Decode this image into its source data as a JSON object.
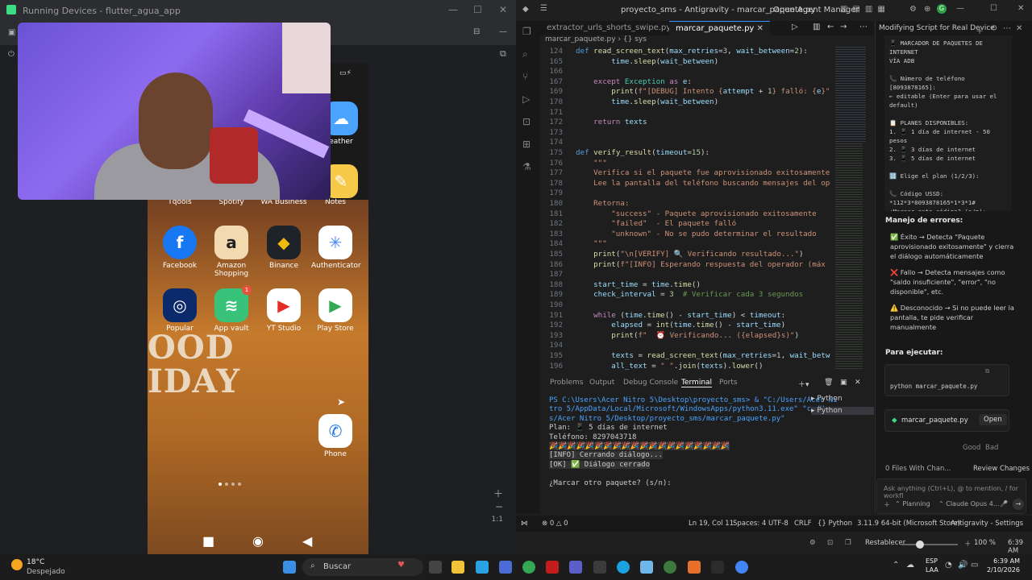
{
  "left_window": {
    "title": "Running Devices - flutter_agua_app",
    "zoom_label": "1:1"
  },
  "phone": {
    "status_battery": "batt",
    "row0": [
      {
        "label": "Tqools"
      },
      {
        "label": "Spotify"
      },
      {
        "label": "WA Business"
      },
      {
        "label": "Notes"
      }
    ],
    "right_partial": [
      {
        "label": "eather"
      }
    ],
    "row1": [
      {
        "label": "Facebook",
        "glyph": "f",
        "color": "#1877f2"
      },
      {
        "label": "Amazon Shopping",
        "glyph": "a",
        "color": "#f3d9b0"
      },
      {
        "label": "Binance",
        "glyph": "◆",
        "color": "#1e2329"
      },
      {
        "label": "Authenticator",
        "glyph": "✳",
        "color": "#ffffff"
      }
    ],
    "row2": [
      {
        "label": "Popular",
        "glyph": "◎",
        "color": "#0b2a6b"
      },
      {
        "label": "App vault",
        "glyph": "≋",
        "color": "#39c27a"
      },
      {
        "label": "YT Studio",
        "glyph": "▶",
        "color": "#ffffff"
      },
      {
        "label": "Play Store",
        "glyph": "▶",
        "color": "#ffffff"
      }
    ],
    "badge": "1",
    "dock": {
      "label": "Phone",
      "glyph": "✆",
      "color": "#ffffff"
    },
    "wall_line1": "OOD",
    "wall_line2": "IDAY"
  },
  "ide": {
    "title": "proyecto_sms - Antigravity - marcar_paquete.py",
    "open_agent": "Open Agent Manager",
    "tabs": [
      {
        "label": "extractor_urls_shorts_swipe.py",
        "active": false
      },
      {
        "label": "marcar_paquete.py",
        "active": true
      }
    ],
    "breadcrumb": "marcar_paquete.py  ›  {} sys",
    "lines": [
      {
        "n": "124",
        "html": "<span class='kw'>def</span> <span class='fn'>read_screen_text</span>(<span class='var'>max_retries</span>=<span class='num'>3</span>, <span class='var'>wait_between</span>=<span class='num'>2</span>):"
      },
      {
        "n": "165",
        "html": "        <span class='var'>time</span>.<span class='fn'>sleep</span>(<span class='var'>wait_between</span>)"
      },
      {
        "n": "166",
        "html": ""
      },
      {
        "n": "167",
        "html": "    <span class='kw2'>except</span> <span class='cls'>Exception</span> <span class='kw2'>as</span> <span class='var'>e</span>:"
      },
      {
        "n": "169",
        "html": "        <span class='fn'>print</span>(<span class='str'>f\"[DEBUG] Intento {</span><span class='var'>attempt</span> + <span class='num'>1</span><span class='str'>} falló: {</span><span class='var'>e</span><span class='str'>}\"</span>"
      },
      {
        "n": "170",
        "html": "        <span class='var'>time</span>.<span class='fn'>sleep</span>(<span class='var'>wait_between</span>)"
      },
      {
        "n": "171",
        "html": ""
      },
      {
        "n": "172",
        "html": "    <span class='kw2'>return</span> <span class='var'>texts</span>"
      },
      {
        "n": "173",
        "html": ""
      },
      {
        "n": "174",
        "html": ""
      },
      {
        "n": "175",
        "html": "<span class='kw'>def</span> <span class='fn'>verify_result</span>(<span class='var'>timeout</span>=<span class='num'>15</span>):"
      },
      {
        "n": "176",
        "html": "    <span class='str'>\"\"\"</span>"
      },
      {
        "n": "177",
        "html": "    <span class='str'>Verifica si el paquete fue aprovisionado exitosamente o f</span>"
      },
      {
        "n": "178",
        "html": "    <span class='str'>Lee la pantalla del teléfono buscando mensajes del operad</span>"
      },
      {
        "n": "179",
        "html": ""
      },
      {
        "n": "180",
        "html": "    <span class='str'>Retorna:</span>"
      },
      {
        "n": "181",
        "html": "        <span class='str'>\"success\" - Paquete aprovisionado exitosamente</span>"
      },
      {
        "n": "182",
        "html": "        <span class='str'>\"failed\"  - El paquete falló</span>"
      },
      {
        "n": "183",
        "html": "        <span class='str'>\"unknown\" - No se pudo determinar el resultado</span>"
      },
      {
        "n": "184",
        "html": "    <span class='str'>\"\"\"</span>"
      },
      {
        "n": "185",
        "html": "    <span class='fn'>print</span>(<span class='str'>\"\\n[VERIFY] 🔍 Verificando resultado...\"</span>)"
      },
      {
        "n": "186",
        "html": "    <span class='fn'>print</span>(<span class='str'>f\"[INFO] Esperando respuesta del operador (máx {tim</span>"
      },
      {
        "n": "187",
        "html": ""
      },
      {
        "n": "188",
        "html": "    <span class='var'>start_time</span> = <span class='var'>time</span>.<span class='fn'>time</span>()"
      },
      {
        "n": "189",
        "html": "    <span class='var'>check_interval</span> = <span class='num'>3</span>  <span class='cm'># Verificar cada 3 segundos</span>"
      },
      {
        "n": "190",
        "html": ""
      },
      {
        "n": "191",
        "html": "    <span class='kw2'>while</span> (<span class='var'>time</span>.<span class='fn'>time</span>() - <span class='var'>start_time</span>) &lt; <span class='var'>timeout</span>:"
      },
      {
        "n": "192",
        "html": "        <span class='var'>elapsed</span> = <span class='fn'>int</span>(<span class='var'>time</span>.<span class='fn'>time</span>() - <span class='var'>start_time</span>)"
      },
      {
        "n": "193",
        "html": "        <span class='fn'>print</span>(<span class='str'>f\"  ⏰ Verificando... ({elapsed}s)\"</span>)"
      },
      {
        "n": "194",
        "html": ""
      },
      {
        "n": "195",
        "html": "        <span class='var'>texts</span> = <span class='fn'>read_screen_text</span>(<span class='var'>max_retries</span>=<span class='num'>1</span>, <span class='var'>wait_between</span>="
      },
      {
        "n": "196",
        "html": "        <span class='var'>all_text</span> = <span class='str'>\" \"</span>.<span class='fn'>join</span>(<span class='var'>texts</span>).<span class='fn'>lower</span>()"
      }
    ],
    "panel_tabs": [
      "Problems",
      "Output",
      "Debug Console",
      "Terminal",
      "Ports"
    ],
    "terminal": [
      "PS C:\\Users\\Acer Nitro 5\\Desktop\\proyecto_sms> & \"C:/Users/Acer Ni",
      "tro 5/AppData/Local/Microsoft/WindowsApps/python3.11.exe\" \"c:/User",
      "s/Acer Nitro 5/Desktop/proyecto_sms/marcar_paquete.py\"",
      "Plan: 📱 5 días de internet",
      "Teléfono: 8297043718",
      "🎉🎉🎉🎉🎉🎉🎉🎉🎉🎉🎉🎉🎉🎉🎉🎉🎉🎉🎉🎉",
      "[INFO] Cerrando diálogo...",
      "[OK] ✅ Diálogo cerrado",
      "",
      "¿Marcar otro paquete? (s/n): "
    ],
    "term_list": [
      "Python",
      "Python"
    ],
    "status": {
      "errors": "⊗ 0 △ 0",
      "pos": "Ln 19, Col 11",
      "spaces": "Spaces: 4",
      "enc": "UTF-8",
      "eol": "CRLF",
      "lang": "{} Python",
      "ver": "3.11.9 64-bit (Microsoft Store)",
      "settings": "Antigravity - Settings"
    }
  },
  "agent": {
    "title": "Modifying Script for Real Device",
    "top_text": [
      "📱 MARCADOR DE PAQUETES DE INTERNET",
      "VÍA ADB",
      "",
      "📞 Número de teléfono [8093878165]:",
      "← editable (Enter para usar el",
      "default)",
      "",
      "📋 PLANES DISPONIBLES:",
      "  1. 📱 1 día de internet - 50",
      "pesos",
      "  2. 📱 3 días de internet",
      "  3. 📱 5 días de internet",
      "",
      "🔢 Elige el plan (1/2/3):",
      "",
      "  📞 Código USSD:",
      "*112*3*8093878165*1*3*1#",
      "  ¿Marcar este código? (s/n):"
    ],
    "errors_title": "Manejo de errores:",
    "bullets": [
      "✅ Éxito → Detecta \"Paquete aprovisionado exitosamente\" y cierra el diálogo automáticamente",
      "❌ Fallo → Detecta mensajes como \"saldo insuficiente\", \"error\", \"no disponible\", etc.",
      "⚠️ Desconocido → Si no puede leer la pantalla, te pide verificar manualmente"
    ],
    "run_title": "Para ejecutar:",
    "cmd": "python marcar_paquete.py",
    "file": "marcar_paquete.py",
    "open_btn": "Open",
    "good": "Good",
    "bad": "Bad",
    "files_changed": "0 Files With Chan...",
    "review": "Review Changes",
    "chat_placeholder": "Ask anything (Ctrl+L), @ to mention, / for workfl",
    "planning": "Planning",
    "model": "Claude Opus 4..."
  },
  "ide_bottom": {
    "restablecer": "Restablecer",
    "zoom": "100 %",
    "time": "6:39 AM"
  },
  "taskbar": {
    "weather_temp": "18°C",
    "weather_desc": "Despejado",
    "search": "Buscar",
    "lang1": "ESP",
    "lang2": "LAA",
    "time": "6:39 AM",
    "date": "2/10/2026"
  }
}
